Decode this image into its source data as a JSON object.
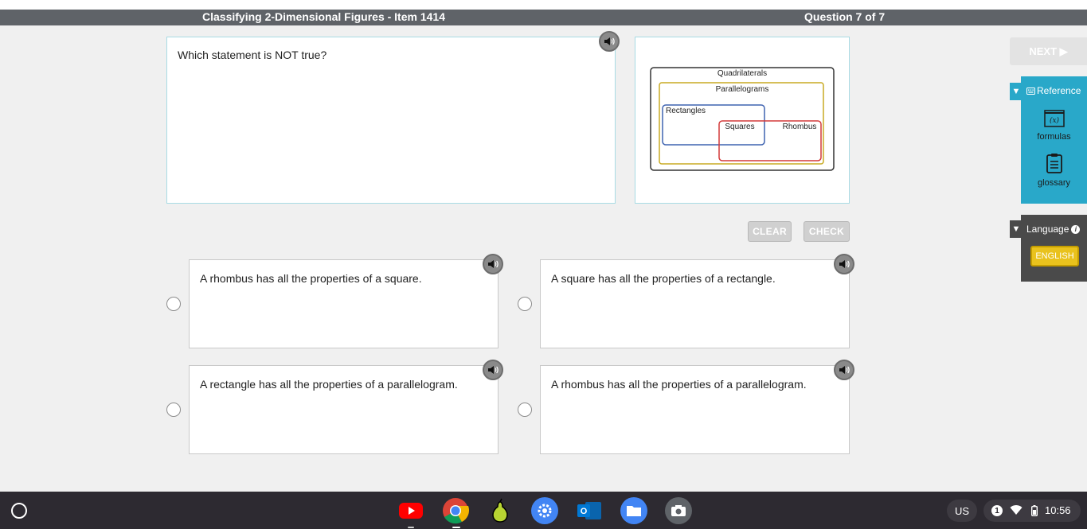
{
  "header": {
    "title": "Classifying 2-Dimensional Figures - Item 1414",
    "progress": "Question 7 of 7"
  },
  "question": {
    "text": "Which statement is NOT true?",
    "audio_icon": "speaker-icon"
  },
  "diagram": {
    "outer": "Quadrilaterals",
    "level2": "Parallelograms",
    "left": "Rectangles",
    "overlap": "Squares",
    "right": "Rhombus",
    "colors": {
      "quadrilaterals": "#333333",
      "parallelograms": "#c8aa22",
      "rectangles": "#3f63b0",
      "rhombus": "#d43a3a"
    }
  },
  "actions": {
    "clear": "CLEAR",
    "check": "CHECK",
    "next": "NEXT ▶"
  },
  "answers": [
    {
      "text": "A rhombus has all the properties of a square."
    },
    {
      "text": "A square has all the properties of a rectangle."
    },
    {
      "text": "A rectangle has all the properties of a parallelogram."
    },
    {
      "text": "A rhombus has all the properties of a parallelogram."
    }
  ],
  "reference": {
    "title": "Reference",
    "items": [
      {
        "label": "formulas",
        "icon": "formula-icon"
      },
      {
        "label": "glossary",
        "icon": "clipboard-icon"
      }
    ]
  },
  "language": {
    "title": "Language",
    "selected": "ENGLISH"
  },
  "taskbar": {
    "apps": [
      "youtube-icon",
      "chrome-icon",
      "pear-icon",
      "settings-icon",
      "outlook-icon",
      "files-icon",
      "camera-icon"
    ],
    "ime": "US",
    "notifications": "1",
    "time": "10:56"
  },
  "colors": {
    "accent": "#29a8c9",
    "titlebar": "#5f6368",
    "taskbar": "#2d2a31",
    "language_button": "#e9c21d"
  }
}
